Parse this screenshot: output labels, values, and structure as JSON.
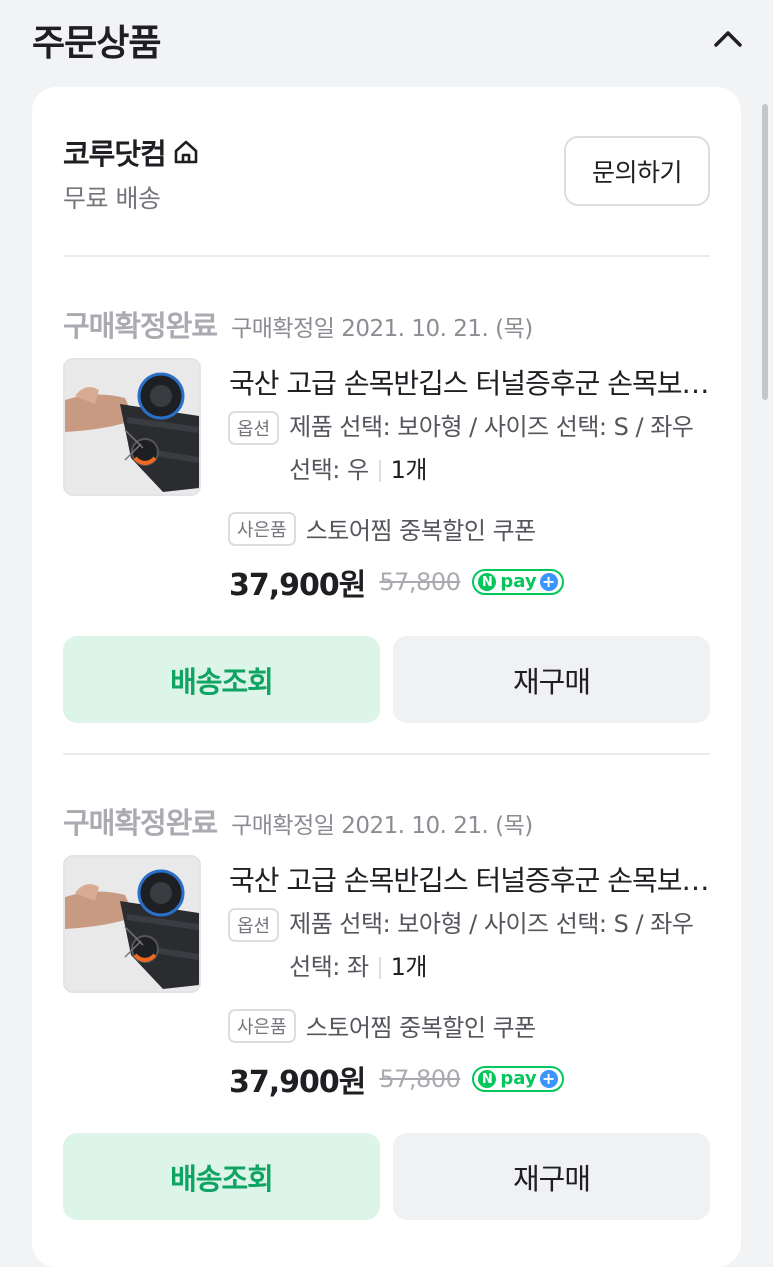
{
  "section": {
    "title": "주문상품",
    "collapse_icon": "chevron-up-icon"
  },
  "seller": {
    "name": "코루닷컴",
    "store_icon": "home-icon",
    "shipping": "무료 배송",
    "inquiry_label": "문의하기"
  },
  "orders": [
    {
      "status": "구매확정완료",
      "date_text": "구매확정일 2021. 10. 21. (목)",
      "product_name": "국산 고급 손목반깁스 터널증후군 손목보호대",
      "option_tag": "옵션",
      "option_text": "제품 선택: 보아형 / 사이즈 선택: S / 좌우 선택: 우",
      "quantity": "1개",
      "gift_tag": "사은품",
      "gift_text": "스토어찜 중복할인 쿠폰",
      "price": "37,900원",
      "original_price": "57,800",
      "npay_label": "pay",
      "track_label": "배송조회",
      "rebuy_label": "재구매"
    },
    {
      "status": "구매확정완료",
      "date_text": "구매확정일 2021. 10. 21. (목)",
      "product_name": "국산 고급 손목반깁스 터널증후군 손목보호대",
      "option_tag": "옵션",
      "option_text": "제품 선택: 보아형 / 사이즈 선택: S / 좌우 선택: 좌",
      "quantity": "1개",
      "gift_tag": "사은품",
      "gift_text": "스토어찜 중복할인 쿠폰",
      "price": "37,900원",
      "original_price": "57,800",
      "npay_label": "pay",
      "track_label": "배송조회",
      "rebuy_label": "재구매"
    }
  ],
  "colors": {
    "accent_green": "#03c75a",
    "track_button_bg": "#ddf4e9",
    "track_button_text": "#0fa462",
    "page_bg": "#f2f3f5"
  }
}
